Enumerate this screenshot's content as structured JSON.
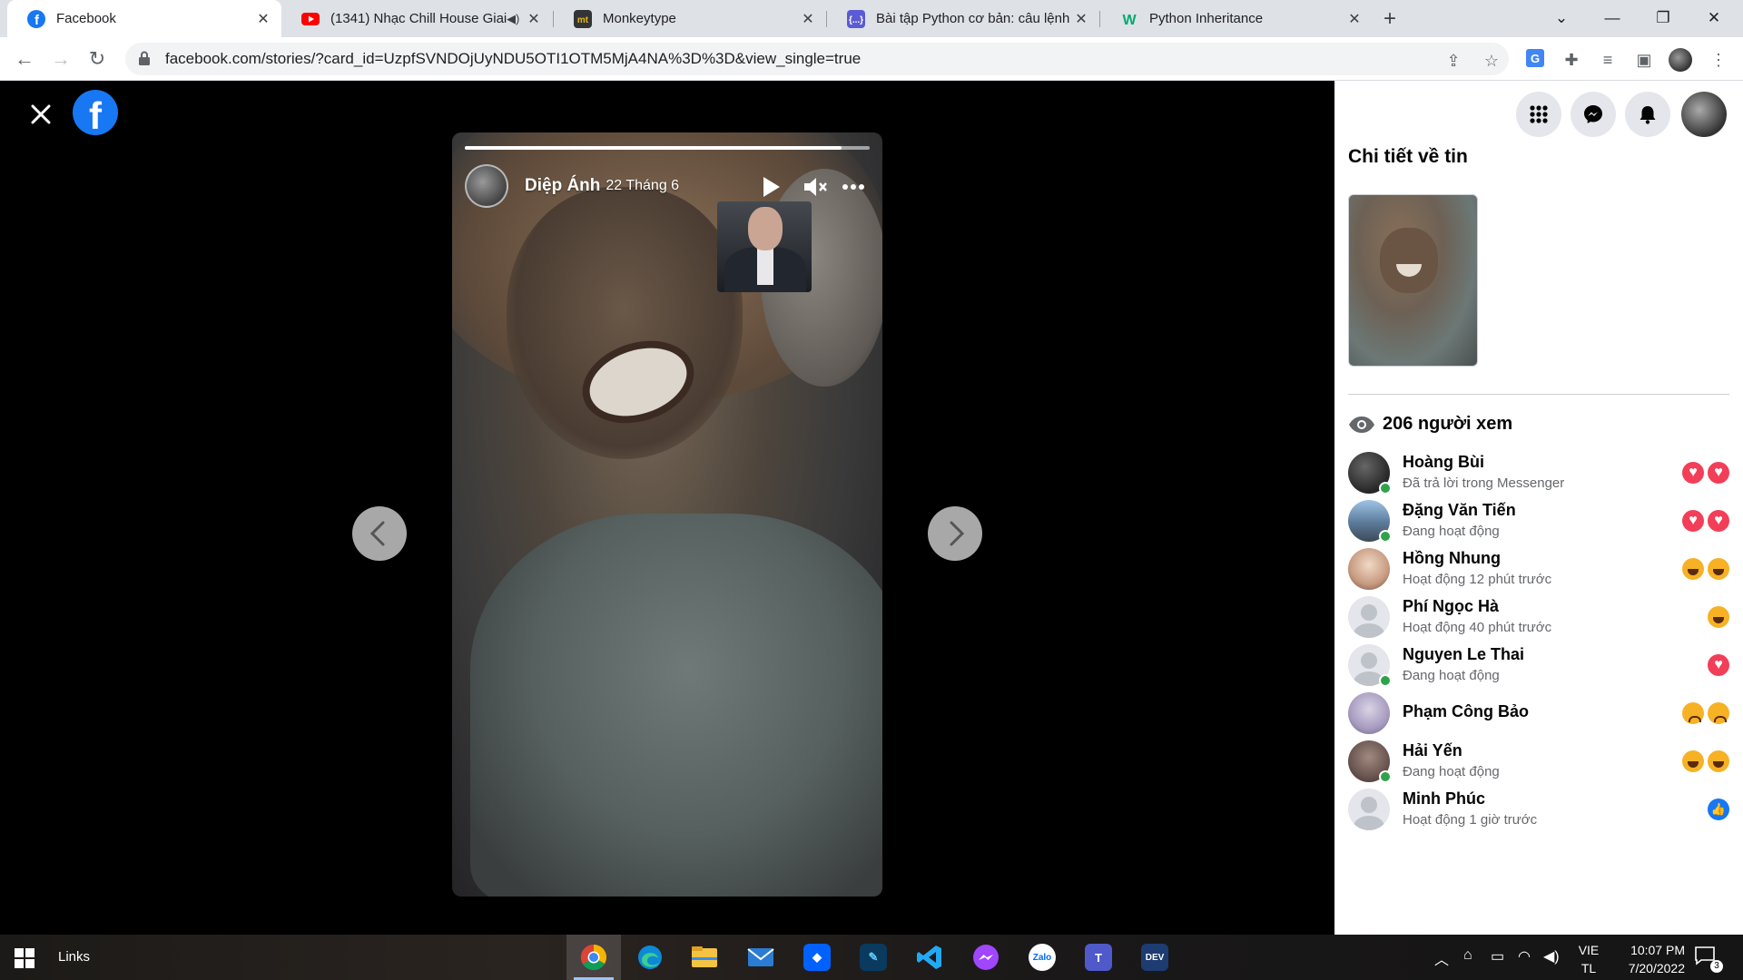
{
  "browser": {
    "tabs": [
      {
        "title": "Facebook",
        "icon": "facebook-icon",
        "active": true
      },
      {
        "title": "(1341) Nhạc Chill House Giai",
        "icon": "youtube-icon",
        "active": false
      },
      {
        "title": "Monkeytype",
        "icon": "monkeytype-icon",
        "active": false
      },
      {
        "title": "Bài tập Python cơ bản: câu lệnh r",
        "icon": "code-icon",
        "active": false
      },
      {
        "title": "Python Inheritance",
        "icon": "w3schools-icon",
        "active": false
      }
    ],
    "url": "facebook.com/stories/?card_id=UzpfSVNDOjUyNDU5OTI1OTM5MjA4NA%3D%3D&view_single=true"
  },
  "story": {
    "author": "Diệp Ánh",
    "date": "22 Tháng 6",
    "progress": 0.93
  },
  "panel": {
    "title": "Chi tiết về tin",
    "viewer_count": "206 người xem",
    "viewers": [
      {
        "name": "Hoàng Bùi",
        "status": "Đã trả lời trong Messenger",
        "online": true,
        "avatar": "photo",
        "reactions": [
          "love",
          "love"
        ]
      },
      {
        "name": "Đặng Văn Tiến",
        "status": "Đang hoạt động",
        "online": true,
        "avatar": "photo",
        "reactions": [
          "love",
          "love"
        ]
      },
      {
        "name": "Hồng Nhung",
        "status": "Hoạt động 12 phút trước",
        "online": false,
        "avatar": "photo",
        "reactions": [
          "haha",
          "haha"
        ]
      },
      {
        "name": "Phí Ngọc Hà",
        "status": "Hoạt động 40 phút trước",
        "online": false,
        "avatar": "default",
        "reactions": [
          "haha"
        ]
      },
      {
        "name": "Nguyen Le Thai",
        "status": "Đang hoạt động",
        "online": true,
        "avatar": "default",
        "reactions": [
          "love"
        ]
      },
      {
        "name": "Phạm Công Bảo",
        "status": "",
        "online": false,
        "avatar": "photo",
        "reactions": [
          "sad",
          "sad"
        ]
      },
      {
        "name": "Hải Yến",
        "status": "Đang hoạt động",
        "online": true,
        "avatar": "photo",
        "reactions": [
          "haha",
          "haha"
        ]
      },
      {
        "name": "Minh Phúc",
        "status": "Hoạt động 1 giờ trước",
        "online": false,
        "avatar": "default",
        "reactions": [
          "like"
        ]
      }
    ]
  },
  "taskbar": {
    "links_label": "Links",
    "apps": [
      "chrome-icon",
      "edge-icon",
      "file-explorer-icon",
      "mail-icon",
      "dropbox-icon",
      "app-icon",
      "vscode-icon",
      "messenger-icon",
      "zalo-icon",
      "teams-icon",
      "devc-icon"
    ],
    "lang_line1": "VIE",
    "lang_line2": "TL",
    "time": "10:07 PM",
    "date": "7/20/2022",
    "notification_count": "3"
  },
  "colors": {
    "fb_blue": "#1877f2",
    "online": "#31a24c"
  }
}
